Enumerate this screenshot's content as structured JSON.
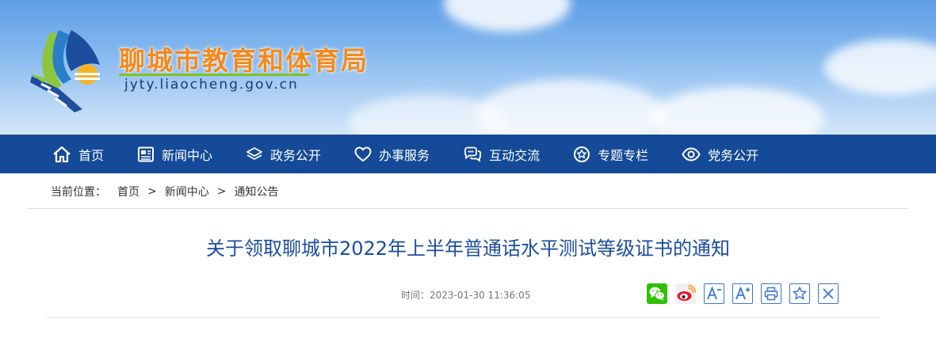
{
  "header": {
    "site_name": "聊城市教育和体育局",
    "site_url": "jyty.liaocheng.gov.cn"
  },
  "nav": {
    "items": [
      {
        "label": "首页",
        "icon": "home-icon"
      },
      {
        "label": "新闻中心",
        "icon": "newspaper-icon"
      },
      {
        "label": "政务公开",
        "icon": "layers-icon"
      },
      {
        "label": "办事服务",
        "icon": "heart-icon"
      },
      {
        "label": "互动交流",
        "icon": "chat-icon"
      },
      {
        "label": "专题专栏",
        "icon": "star-badge-icon"
      },
      {
        "label": "党务公开",
        "icon": "eye-icon"
      }
    ]
  },
  "breadcrumb": {
    "prefix": "当前位置：",
    "items": [
      "首页",
      "新闻中心",
      "通知公告"
    ],
    "separator": ">"
  },
  "article": {
    "title": "关于领取聊城市2022年上半年普通话水平测试等级证书的通知",
    "time": "时间：2023-01-30 11:36:05"
  },
  "tools": [
    "wechat-share-icon",
    "weibo-share-icon",
    "font-smaller-icon",
    "font-larger-icon",
    "print-icon",
    "favorite-icon",
    "close-icon"
  ],
  "colors": {
    "nav_bg": "#144a97",
    "title": "#1b4c9c",
    "site_name": "#f28a1e",
    "tool_border": "#3a78c9"
  }
}
